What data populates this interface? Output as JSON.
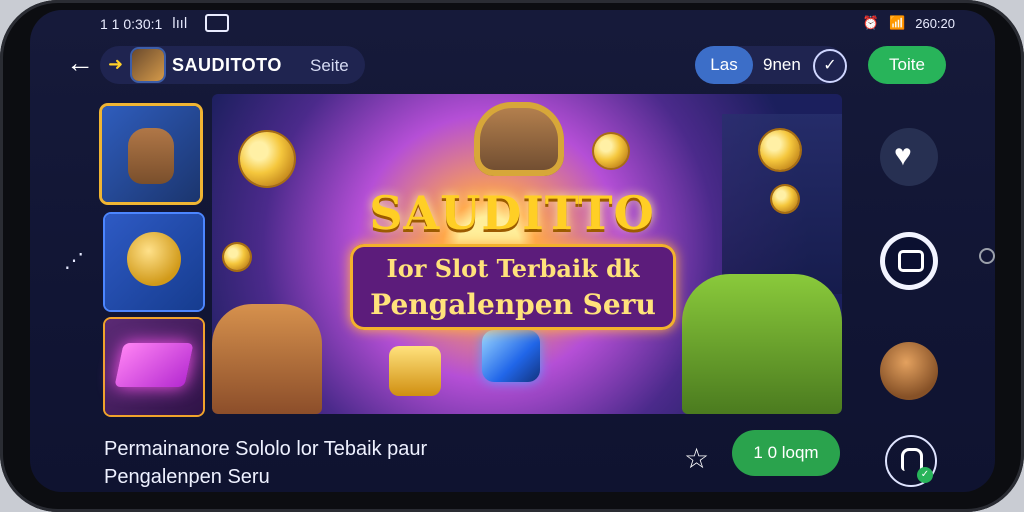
{
  "status": {
    "time": "1 1 0:30:1",
    "signal": "lııl",
    "right_text": "260:20"
  },
  "topbar": {
    "brand_name": "SAUDITOTO",
    "brand_sub": "Seite",
    "seg_left": "Las",
    "seg_right": "9nen",
    "action_label": "Toite"
  },
  "banner": {
    "title": "SAUDITTO",
    "line1": "Ior Slot Terbaik dk",
    "line2": "Pengalenpen Seru"
  },
  "bottom": {
    "line1": "Permainanore Sololo lor Tebaik paur",
    "line2": "Pengalenpen Seru",
    "play_label": "1 0 loqm"
  },
  "colors": {
    "accent_green": "#2aa34d",
    "accent_blue": "#3c6ec8",
    "screen_bg": "#111534"
  },
  "icons": {
    "back": "arrow-left-icon",
    "brand": "arrow-right-icon",
    "share": "share-icon",
    "heart": "heart-icon",
    "camera": "camera-icon",
    "avatar": "avatar-icon",
    "star": "star-icon",
    "profile": "profile-icon",
    "check": "check-icon"
  }
}
